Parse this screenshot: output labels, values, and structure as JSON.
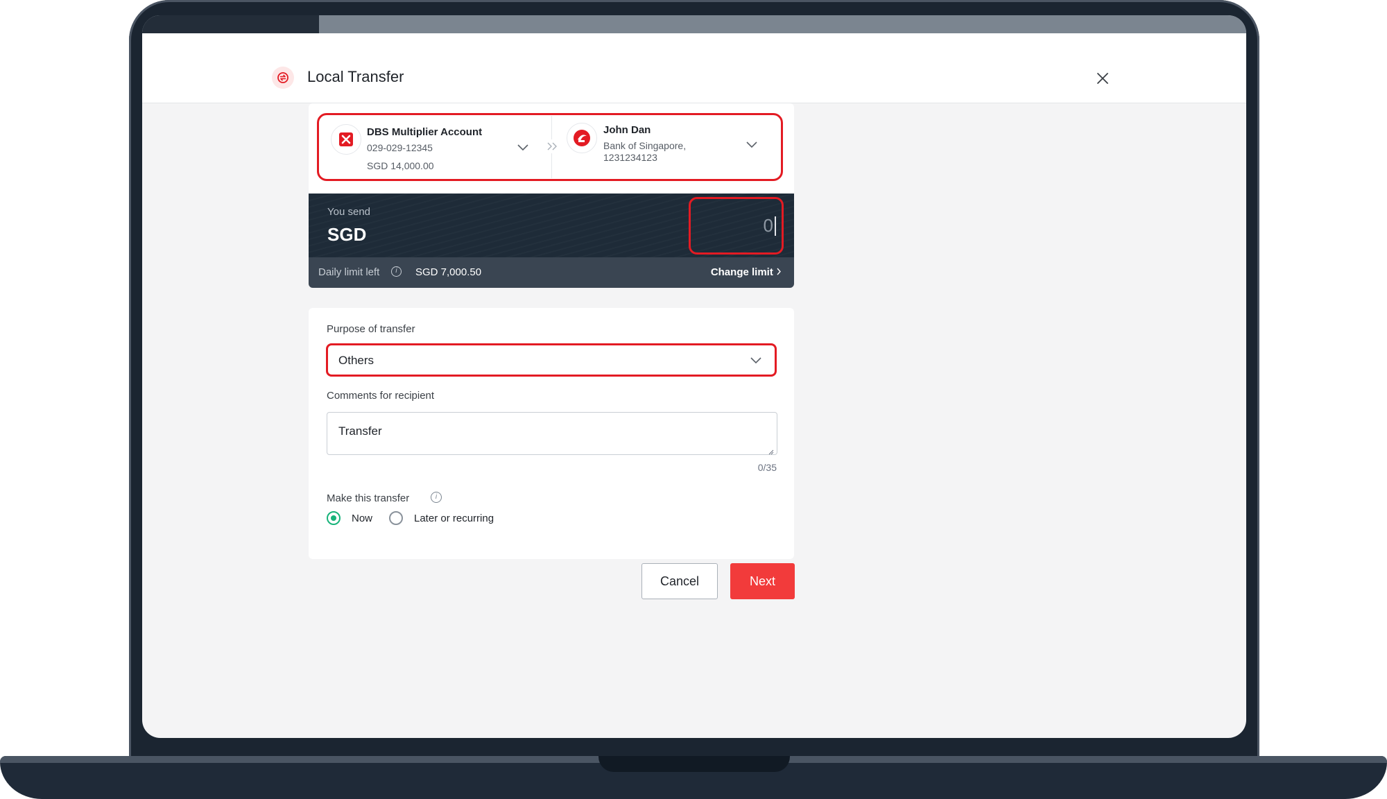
{
  "header": {
    "title": "Local Transfer",
    "icon": "transfer-icon",
    "close_icon": "close-icon"
  },
  "progress": {
    "fraction": 0.16
  },
  "from_account": {
    "name": "DBS Multiplier Account",
    "number": "029-029-12345",
    "balance": "SGD  14,000.00",
    "icon": "dbs-logo-icon"
  },
  "to_account": {
    "name": "John Dan",
    "bank": "Bank of Singapore,",
    "number": "1231234123",
    "icon": "bank-of-singapore-logo-icon"
  },
  "send": {
    "label": "You send",
    "currency": "SGD",
    "amount": "0"
  },
  "limit": {
    "label": "Daily limit left",
    "value": "SGD 7,000.50",
    "change_label": "Change limit"
  },
  "form": {
    "purpose_label": "Purpose of transfer",
    "purpose_value": "Others",
    "comments_label": "Comments for recipient",
    "comments_value": "Transfer",
    "char_count": "0/35",
    "schedule_label": "Make this transfer",
    "options": [
      {
        "label": "Now",
        "checked": true
      },
      {
        "label": "Later or recurring",
        "checked": false
      }
    ]
  },
  "buttons": {
    "cancel": "Cancel",
    "next": "Next"
  },
  "colors": {
    "accent_red": "#f23b3b",
    "highlight_red": "#e31b23",
    "dark_panel": "#1e2b38",
    "radio_green": "#18b37a"
  }
}
